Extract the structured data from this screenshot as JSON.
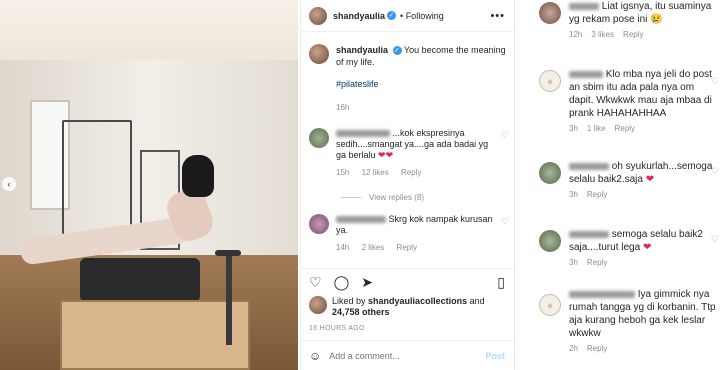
{
  "post": {
    "username": "shandyaulia",
    "follow_status": "Following",
    "caption": "You become the meaning of my life.",
    "hashtag": "#pilateslife",
    "caption_age": "16h"
  },
  "comments": [
    {
      "text": "...kok ekspresinya sedih....smangat ya....ga ada badai yg ga berlalu",
      "age": "15h",
      "likes": "12 likes",
      "reply": "Reply"
    },
    {
      "text": "Skrg kok nampak kurusan ya.",
      "age": "14h",
      "likes": "2 likes",
      "reply": "Reply"
    }
  ],
  "view_replies": "View replies (8)",
  "liked_by": {
    "text": "Liked by",
    "user": "shandyauliacollections",
    "and": "and",
    "others": "24,758 others"
  },
  "time_ago": "16 HOURS AGO",
  "add_comment_placeholder": "Add a comment...",
  "post_label": "Post",
  "right_comments": [
    {
      "text": "Liat igsnya, itu suaminya yg rekam pose ini",
      "age": "12h",
      "likes": "3 likes",
      "reply": "Reply"
    },
    {
      "text": "Klo mba nya jeli do post an sbim itu ada pala nya om dapit. Wkwkwk mau aja mbaa di prank HAHAHAHHAA",
      "age": "3h",
      "likes": "1 like",
      "reply": "Reply"
    },
    {
      "text": "oh syukurlah...semoga selalu baik2.saja",
      "age": "3h",
      "reply": "Reply"
    },
    {
      "text": "semoga selalu baik2 saja....turut lega",
      "age": "3h",
      "reply": "Reply"
    },
    {
      "text": "Iya gimmick nya rumah tangga yg di korbanin. Ttp aja kurang heboh ga kek leslar wkwkw",
      "age": "2h",
      "reply": "Reply"
    }
  ],
  "colors": {
    "verified": "#3897f0",
    "heart": "#e0245e",
    "hashtag": "#00376b",
    "post_disabled": "#b3dbff",
    "muted": "#8e8e8e"
  },
  "icons": {
    "heart": "heart-outline-icon",
    "comment": "comment-icon",
    "share": "send-icon",
    "bookmark": "bookmark-icon",
    "more": "more-options-icon",
    "emoji": "emoji-icon"
  }
}
